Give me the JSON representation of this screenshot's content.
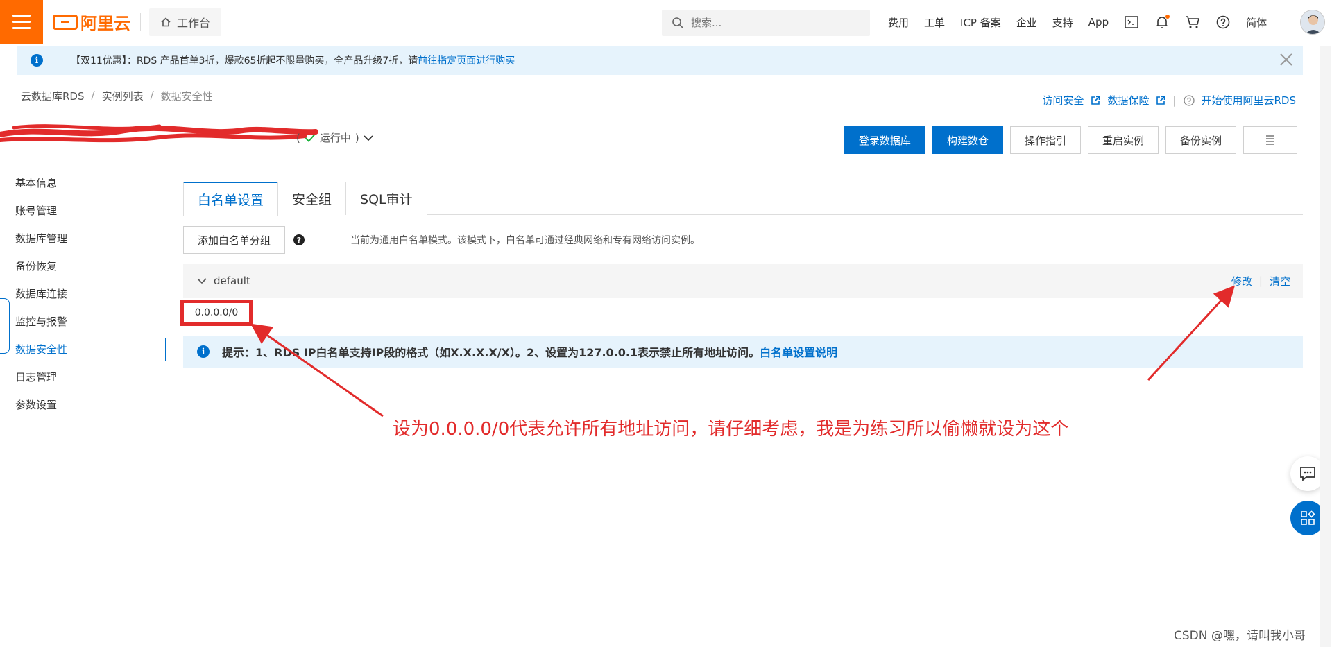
{
  "topbar": {
    "logo_text": "阿里云",
    "workbench_label": "工作台",
    "search_placeholder": "搜索...",
    "links": [
      "费用",
      "工单",
      "ICP 备案",
      "企业",
      "支持",
      "App"
    ],
    "lang_label": "简体",
    "accent_color": "#ff6a00"
  },
  "banner": {
    "text": "【双11优惠】：RDS 产品首单3折，爆款65折起不限量购买，全产品升级7折，请",
    "link": "前往指定页面进行购买"
  },
  "breadcrumb": [
    "云数据库RDS",
    "实例列表",
    "数据安全性"
  ],
  "header_links": {
    "access_security": "访问安全",
    "data_protection": "数据保险",
    "get_started": "开始使用阿里云RDS"
  },
  "instance": {
    "status": "运行中"
  },
  "actions": [
    "登录数据库",
    "构建数仓",
    "操作指引",
    "重启实例",
    "备份实例"
  ],
  "sidebar": {
    "items": [
      "基本信息",
      "账号管理",
      "数据库管理",
      "备份恢复",
      "数据库连接",
      "监控与报警",
      "数据安全性",
      "日志管理",
      "参数设置"
    ],
    "active_index": 6
  },
  "tabs": [
    "白名单设置",
    "安全组",
    "SQL审计"
  ],
  "whitelist": {
    "add_group_button": "添加白名单分组",
    "mode_description": "当前为通用白名单模式。该模式下，白名单可通过经典网络和专有网络访问实例。",
    "group_name": "default",
    "edit_label": "修改",
    "clear_label": "清空",
    "ip": "0.0.0.0/0",
    "tip_text": "提示：1、RDS IP白名单支持IP段的格式（如X.X.X.X/X）。2、设置为127.0.0.1表示禁止所有地址访问。",
    "tip_link": "白名单设置说明"
  },
  "annotation": {
    "text": "设为0.0.0.0/0代表允许所有地址访问，请仔细考虑，我是为练习所以偷懒就设为这个",
    "color": "#e22b2b"
  },
  "watermark": "CSDN @嘿，请叫我小哥",
  "colors": {
    "primary": "#0070cc",
    "banner_bg": "#e6f3fc"
  }
}
